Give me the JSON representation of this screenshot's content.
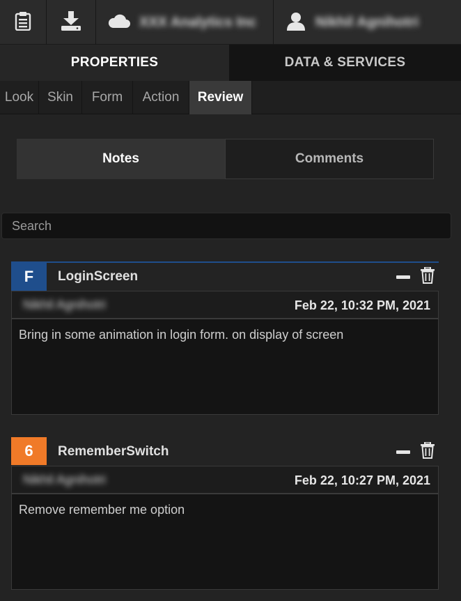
{
  "toolbar": {
    "notes_icon": "clipboard-icon",
    "download_icon": "download-icon",
    "cloud_icon": "cloud-icon",
    "account_name": "XXX Analytics Inc",
    "user_icon": "user-icon",
    "user_name": "Nikhil Agnihotri"
  },
  "main_tabs": [
    {
      "label": "PROPERTIES",
      "active": true
    },
    {
      "label": "DATA & SERVICES",
      "active": false
    }
  ],
  "sub_tabs": [
    {
      "label": "Look"
    },
    {
      "label": "Skin"
    },
    {
      "label": "Form"
    },
    {
      "label": "Action"
    },
    {
      "label": "Review",
      "active": true
    }
  ],
  "segment": {
    "notes_label": "Notes",
    "comments_label": "Comments",
    "selected": "Notes"
  },
  "search": {
    "placeholder": "Search",
    "value": ""
  },
  "notes": [
    {
      "badge": "F",
      "badge_color": "#1f4e8c",
      "title": "LoginScreen",
      "author": "Nikhil Agnihotri",
      "date": "Feb 22, 10:32 PM, 2021",
      "text": "Bring in some animation in login form. on display of screen"
    },
    {
      "badge": "6",
      "badge_color": "#f07a28",
      "title": "RememberSwitch",
      "author": "Nikhil Agnihotri",
      "date": "Feb 22, 10:27 PM, 2021",
      "text": "Remove remember me option"
    }
  ],
  "colors": {
    "background": "#232323",
    "accent_blue": "#1f4e8c",
    "accent_orange": "#f07a28"
  }
}
